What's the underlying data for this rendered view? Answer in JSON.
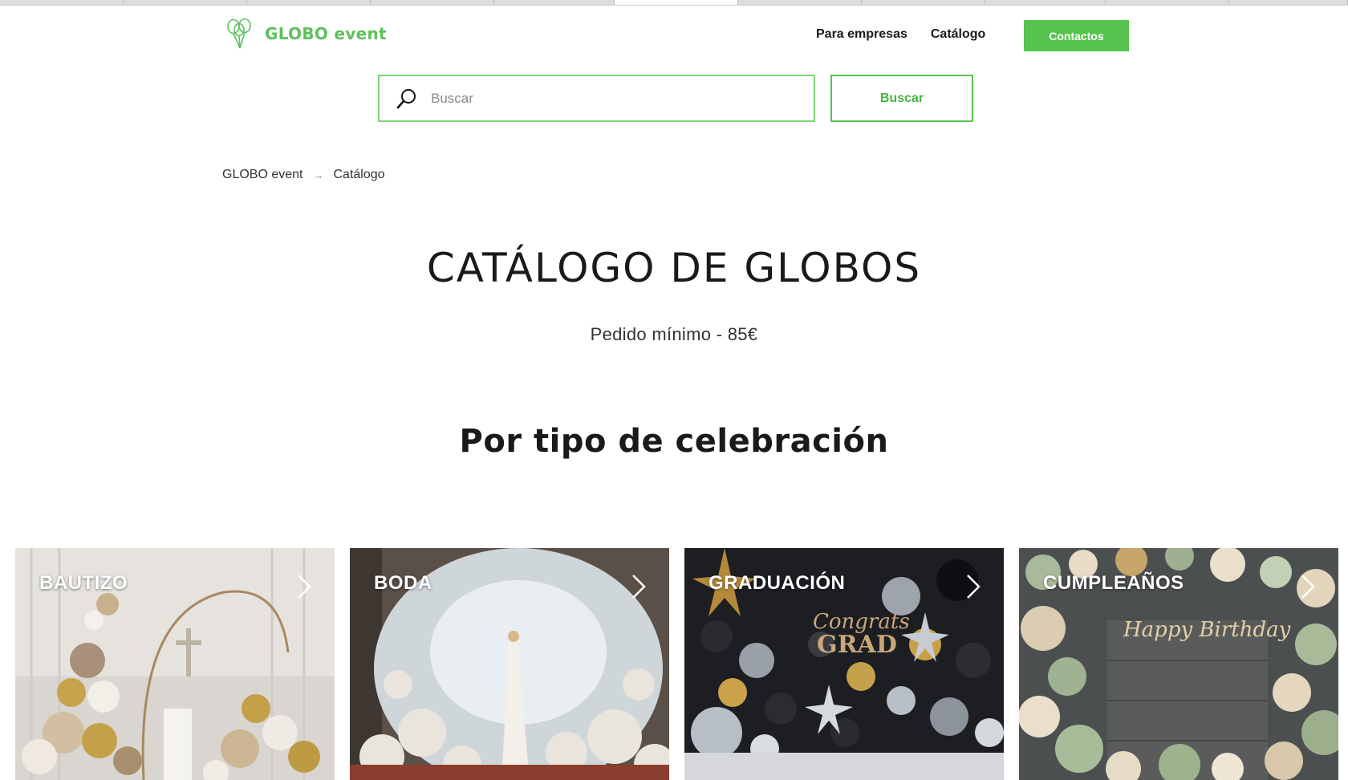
{
  "brand": {
    "name": "GLOBO event",
    "accent": "#56c44f"
  },
  "nav": {
    "items": [
      {
        "label": "Para empresas"
      },
      {
        "label": "Catálogo"
      }
    ],
    "contact_label": "Contactos"
  },
  "search": {
    "placeholder": "Buscar",
    "value": "",
    "button_label": "Buscar"
  },
  "breadcrumb": {
    "home": "GLOBO event",
    "separator": "→",
    "current": "Catálogo"
  },
  "page": {
    "title": "CATÁLOGO DE GLOBOS",
    "subtitle": "Pedido mínimo - 85€",
    "section_title": "Por tipo de celebración"
  },
  "categories": [
    {
      "label": "BAUTIZO"
    },
    {
      "label": "BODA"
    },
    {
      "label": "GRADUACIÓN"
    },
    {
      "label": "CUMPLEAÑOS"
    }
  ]
}
